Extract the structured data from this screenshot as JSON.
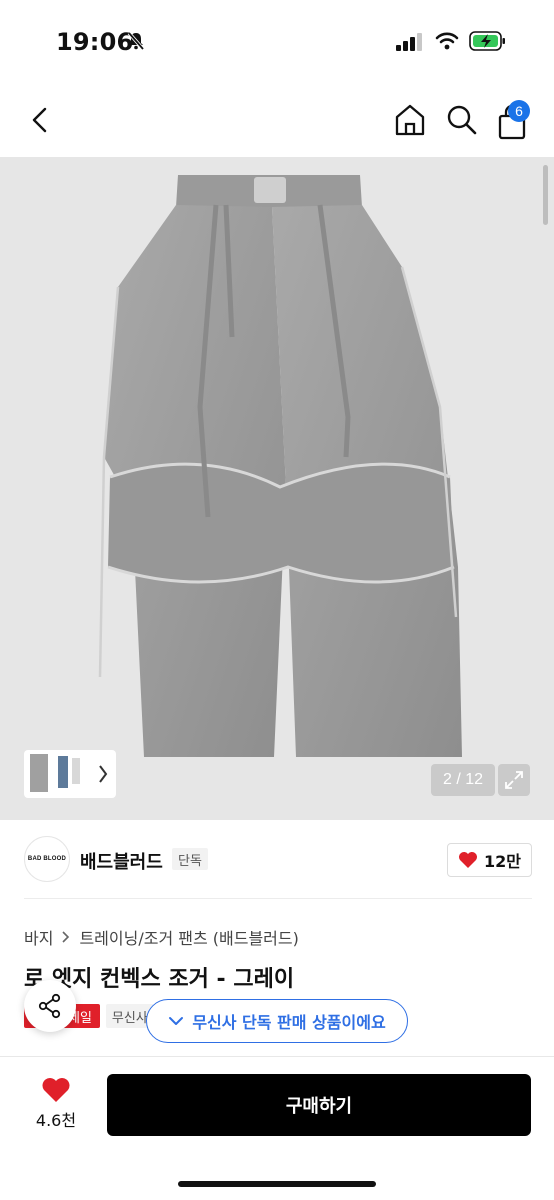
{
  "status": {
    "time": "19:06"
  },
  "nav": {
    "cart_count": "6"
  },
  "gallery": {
    "counter": "2 / 12"
  },
  "brand": {
    "logo_text": "BAD BLOOD",
    "name": "배드블러드",
    "exclusive_tag": "단독",
    "likes": "12만"
  },
  "product": {
    "category_root": "바지",
    "category_path": "트레이닝/조거 팬츠 (배드블러드)",
    "title": "로 엣지 컨벡스 조거 - 그레이",
    "sale_badge": "세일",
    "musinsa_badge": "무신사"
  },
  "toast": {
    "text": "무신사 단독 판매 상품이에요"
  },
  "bottom": {
    "wish_count": "4.6천",
    "buy_label": "구매하기"
  },
  "colors": {
    "accent": "#2f6fe4",
    "sale": "#e0202a",
    "like": "#e0202a"
  }
}
